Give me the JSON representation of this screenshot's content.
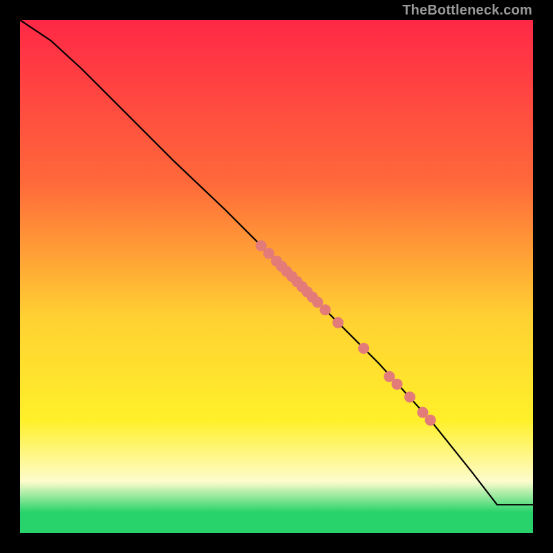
{
  "watermark": "TheBottleneck.com",
  "colors": {
    "bg": "#000000",
    "curve": "#000000",
    "dot": "#e37b78",
    "grad_top": "#ff2846",
    "grad_mid1": "#ff6a3a",
    "grad_mid2": "#ffd132",
    "grad_mid3": "#fff02a",
    "grad_pale": "#fdfccd",
    "grad_green": "#27d36a"
  },
  "chart_data": {
    "type": "line",
    "title": "",
    "xlabel": "",
    "ylabel": "",
    "xlim": [
      0,
      100
    ],
    "ylim": [
      0,
      100
    ],
    "curve": {
      "x": [
        0,
        6,
        12,
        20,
        30,
        40,
        50,
        60,
        70,
        80,
        88,
        93,
        100
      ],
      "y": [
        100,
        96,
        90.5,
        82.5,
        72.5,
        63,
        53,
        43,
        33,
        22,
        12,
        5.5,
        5.5
      ]
    },
    "series": [
      {
        "name": "points-on-curve",
        "x": [
          47,
          48.5,
          50,
          51,
          52,
          53,
          54,
          55,
          56,
          57,
          58,
          59.5,
          62,
          67,
          72,
          73.5,
          76,
          78.5,
          80
        ],
        "y": [
          56,
          54.5,
          53,
          52,
          51,
          50,
          49,
          48,
          47,
          46,
          45,
          43.5,
          41,
          36,
          30.5,
          29,
          26.5,
          23.5,
          22
        ]
      }
    ]
  }
}
